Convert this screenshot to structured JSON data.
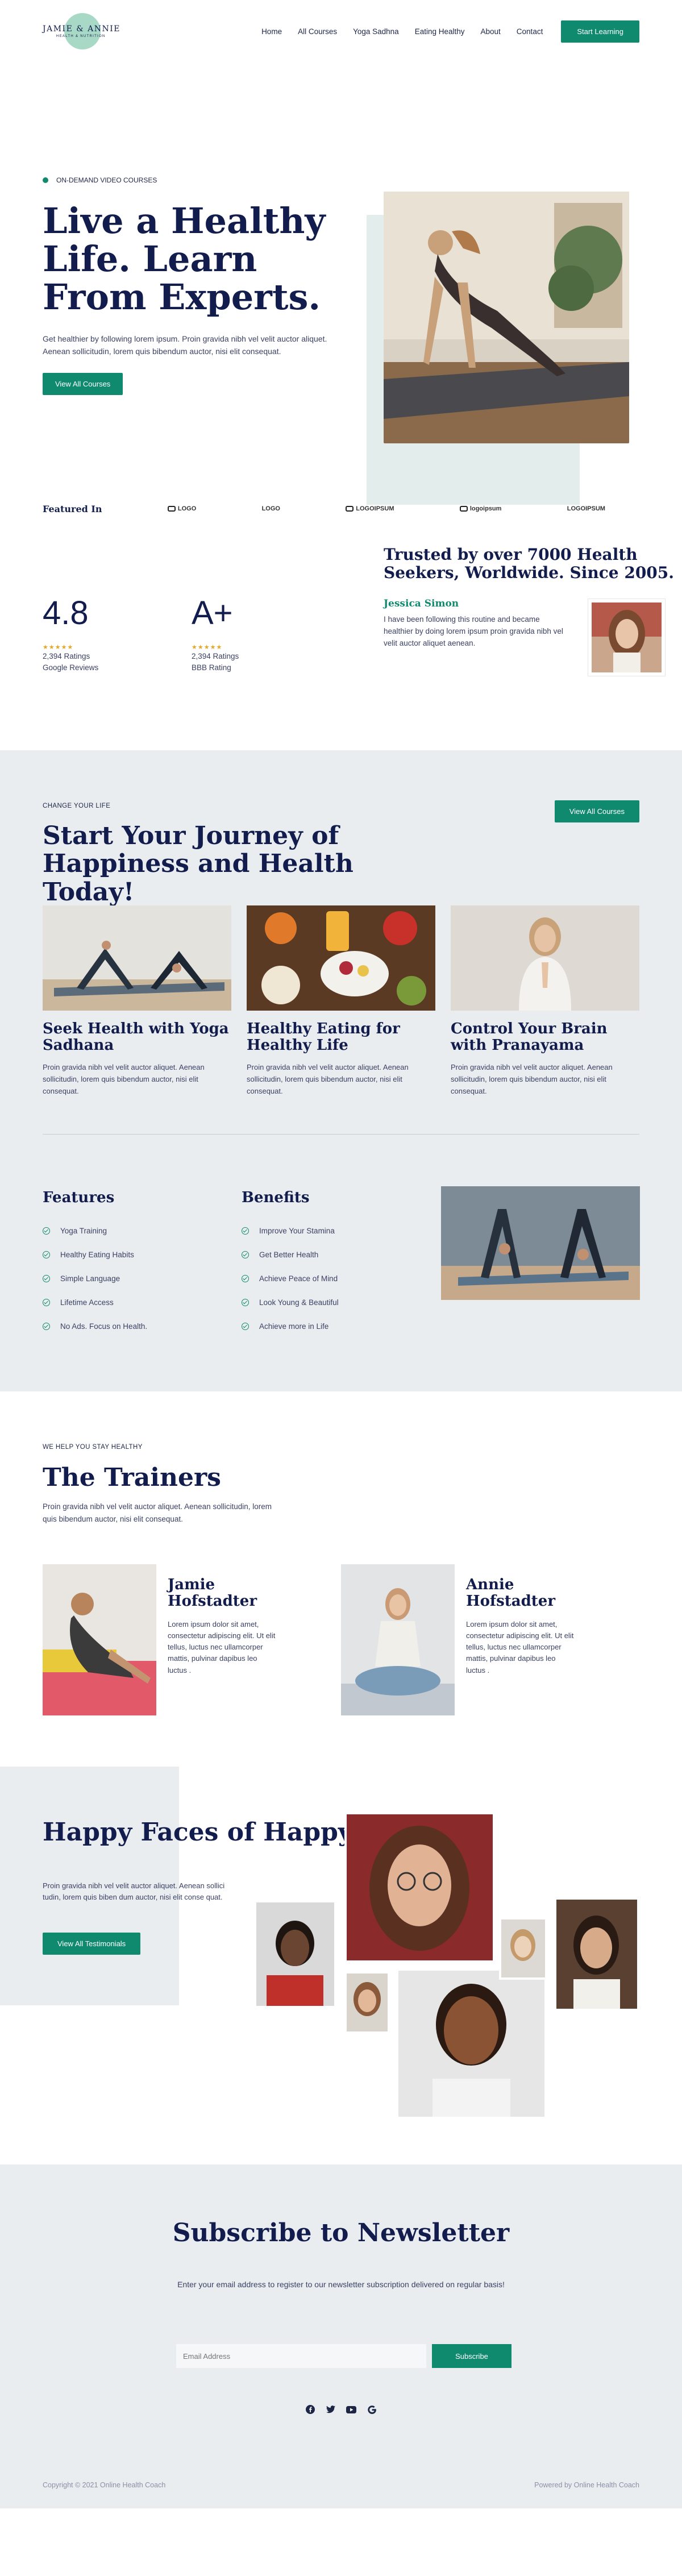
{
  "header": {
    "logo_name": "JAMIE & ANNIE",
    "logo_sub": "HEALTH & NUTRITION",
    "nav": [
      "Home",
      "All Courses",
      "Yoga Sadhna",
      "Eating Healthy",
      "About",
      "Contact"
    ],
    "cta": "Start Learning"
  },
  "hero": {
    "eyebrow": "ON-DEMAND VIDEO COURSES",
    "title": "Live a Healthy Life. Learn From Experts.",
    "text": "Get healthier by following lorem ipsum. Proin gravida nibh vel velit auctor aliquet. Aenean sollicitudin, lorem quis bibendum auctor, nisi elit consequat.",
    "button": "View All Courses"
  },
  "featured": {
    "title": "Featured In",
    "brands": [
      "LOGO",
      "LOGO",
      "LOGOIPSUM",
      "logoipsum",
      "LOGOIPSUM"
    ]
  },
  "stats": {
    "stat1": {
      "value": "4.8",
      "stars": "★★★★★",
      "line1": "2,394 Ratings",
      "line2": "Google Reviews"
    },
    "stat2": {
      "value": "A+",
      "stars": "★★★★★",
      "line1": "2,394 Ratings",
      "line2": "BBB Rating"
    },
    "trusted_title": "Trusted by over 7000 Health Seekers, Worldwide. Since 2005.",
    "testimonial_name": "Jessica Simon",
    "testimonial_text": "I have been following this routine and became healthier by doing lorem ipsum proin gravida nibh vel velit auctor aliquet aenean."
  },
  "journey": {
    "eyebrow": "CHANGE YOUR LIFE",
    "title": "Start Your Journey of Happiness and Health Today!",
    "button": "View All Courses",
    "cards": [
      {
        "title": "Seek Health with Yoga Sadhana",
        "text": "Proin gravida nibh vel velit auctor aliquet. Aenean sollicitudin, lorem quis bibendum auctor, nisi elit consequat."
      },
      {
        "title": "Healthy Eating for Healthy Life",
        "text": "Proin gravida nibh vel velit auctor aliquet. Aenean sollicitudin, lorem quis bibendum auctor, nisi elit consequat."
      },
      {
        "title": "Control Your Brain with Pranayama",
        "text": "Proin gravida nibh vel velit auctor aliquet. Aenean sollicitudin, lorem quis bibendum auctor, nisi elit consequat."
      }
    ],
    "features_title": "Features",
    "features": [
      "Yoga Training",
      "Healthy Eating Habits",
      "Simple Language",
      "Lifetime Access",
      "No Ads. Focus on Health."
    ],
    "benefits_title": "Benefits",
    "benefits": [
      "Improve Your Stamina",
      "Get Better Health",
      "Achieve Peace of Mind",
      "Look Young & Beautiful",
      "Achieve more in Life"
    ]
  },
  "trainers": {
    "eyebrow": "WE HELP YOU STAY HEALTHY",
    "title": "The Trainers",
    "intro": "Proin gravida nibh vel velit auctor aliquet. Aenean sollicitudin, lorem quis bibendum auctor, nisi elit consequat.",
    "items": [
      {
        "name": "Jamie Hofstadter",
        "bio": "Lorem ipsum dolor sit amet, consectetur adipiscing elit. Ut elit tellus, luctus nec ullamcorper mattis, pulvinar dapibus leo luctus ."
      },
      {
        "name": "Annie Hofstadter",
        "bio": "Lorem ipsum dolor sit amet, consectetur adipiscing elit. Ut elit tellus, luctus nec ullamcorper mattis, pulvinar dapibus leo luctus ."
      }
    ]
  },
  "happy": {
    "title": "Happy Faces of Happy Students",
    "text": "Proin gravida nibh vel velit auctor aliquet. Aenean sollici tudin, lorem quis biben dum auctor, nisi elit conse quat.",
    "button": "View All Testimonials"
  },
  "newsletter": {
    "title": "Subscribe to Newsletter",
    "text": "Enter your email address to register to our newsletter subscription delivered on regular basis!",
    "placeholder": "Email Address",
    "button": "Subscribe",
    "social": [
      "facebook-icon",
      "twitter-icon",
      "youtube-icon",
      "google-icon"
    ]
  },
  "footer": {
    "copyright": "Copyright © 2021 Online Health Coach",
    "powered": "Powered by Online Health Coach"
  },
  "colors": {
    "accent": "#0f8a6e",
    "navy": "#121c4d",
    "grey_bg": "#eaedf0",
    "mint": "#a7d9c6"
  }
}
